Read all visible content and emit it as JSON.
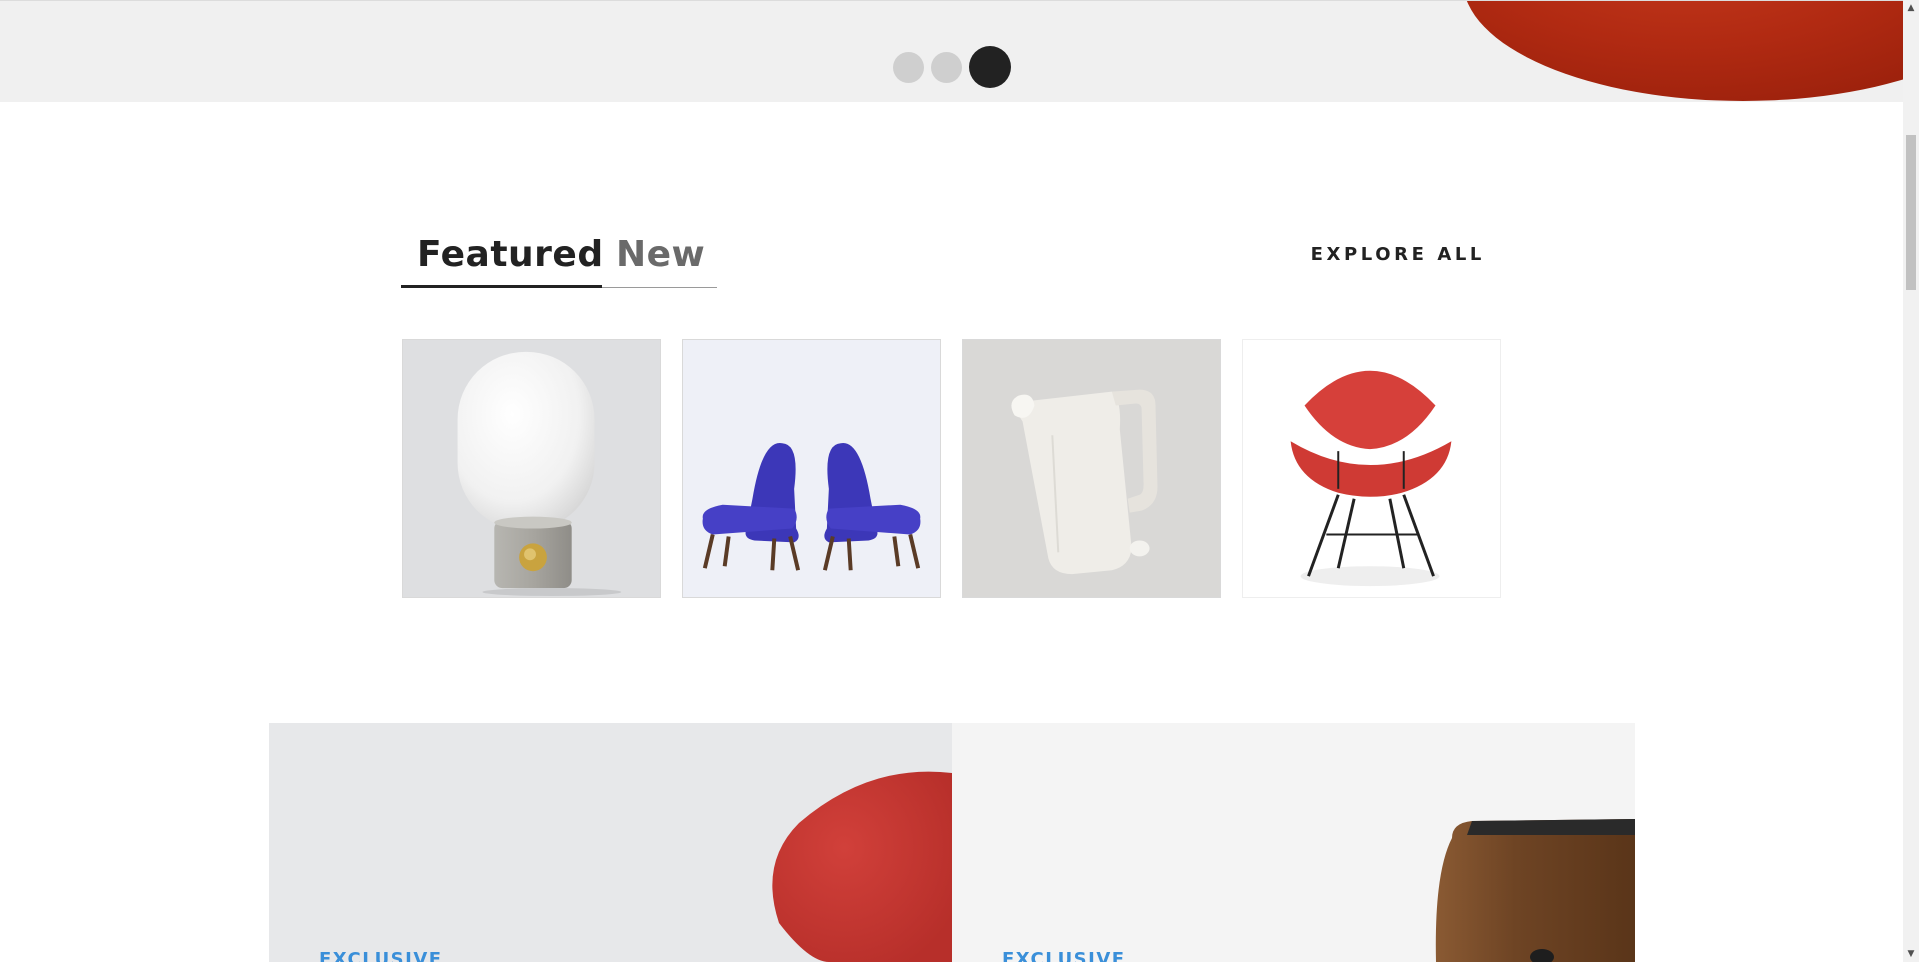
{
  "slider": {
    "dots": [
      {
        "label": "slide-1",
        "active": false
      },
      {
        "label": "slide-2",
        "active": false
      },
      {
        "label": "slide-3",
        "active": true
      }
    ],
    "accent_color": "#b12a12"
  },
  "tabs": {
    "items": [
      {
        "label": "Featured",
        "active": true
      },
      {
        "label": "New",
        "active": false
      }
    ]
  },
  "explore_label": "EXPLORE ALL",
  "products": [
    {
      "name": "lamp",
      "icon": "globe-lamp-icon"
    },
    {
      "name": "armchairs",
      "icon": "blue-armchairs-icon"
    },
    {
      "name": "pitcher",
      "icon": "ceramic-pitcher-icon"
    },
    {
      "name": "chair",
      "icon": "red-shell-chair-icon"
    }
  ],
  "promos": [
    {
      "tag": "EXCLUSIVE",
      "bg": "#e7e8ea"
    },
    {
      "tag": "EXCLUSIVE",
      "bg": "#f4f4f4"
    }
  ],
  "colors": {
    "dark": "#222222",
    "muted": "#6a6a6a",
    "accent_blue": "#3a8fd9",
    "red": "#d6403a",
    "blue_chair": "#3c37b8"
  }
}
